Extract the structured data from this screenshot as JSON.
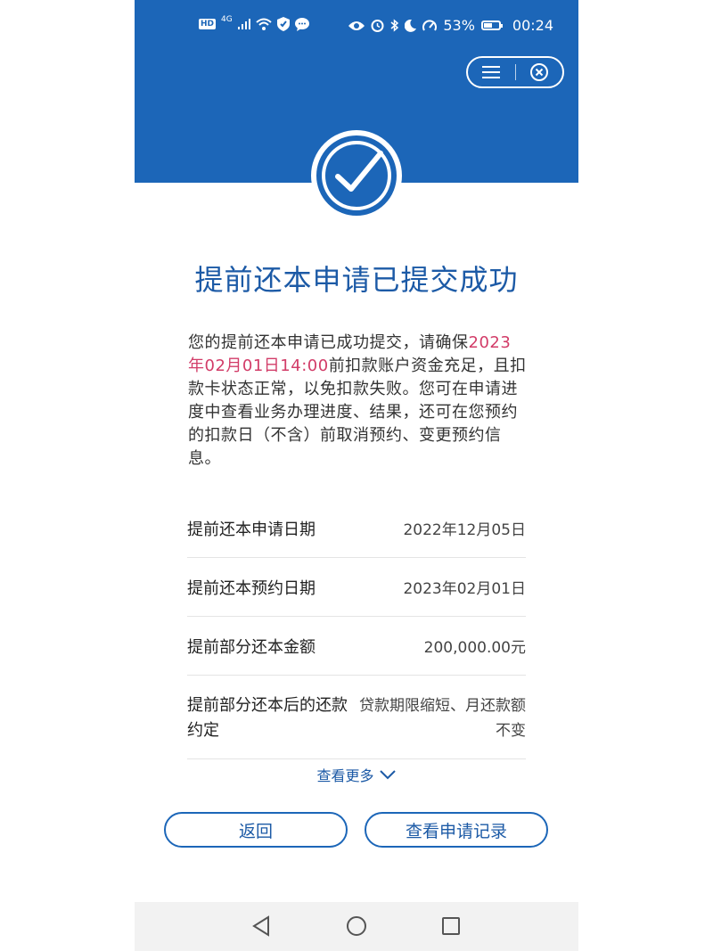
{
  "status_bar": {
    "network": "4G",
    "battery": "53%",
    "time": "00:24",
    "hd": "HD"
  },
  "icons": {
    "menu": "menu-icon",
    "close": "close-icon",
    "success": "check-circle-icon",
    "chevron": "chevron-down-icon"
  },
  "colors": {
    "brand": "#1c66b8",
    "highlight": "#d23c68"
  },
  "page": {
    "title": "提前还本申请已提交成功",
    "desc_part1": "您的提前还本申请已成功提交，请确保",
    "desc_highlight": "2023年02月01日14:00",
    "desc_part2": "前扣款账户资金充足，且扣款卡状态正常，以免扣款失败。您可在申请进度中查看业务办理进度、结果，还可在您预约的扣款日（不含）前取消预约、变更预约信息。"
  },
  "details": [
    {
      "label": "提前还本申请日期",
      "value": "2022年12月05日"
    },
    {
      "label": "提前还本预约日期",
      "value": "2023年02月01日"
    },
    {
      "label": "提前部分还本金额",
      "value": "200,000.00元"
    },
    {
      "label": "提前部分还本后的还款约定",
      "value": "贷款期限缩短、月还款额不变"
    }
  ],
  "more_label": "查看更多",
  "buttons": {
    "back": "返回",
    "record": "查看申请记录"
  }
}
